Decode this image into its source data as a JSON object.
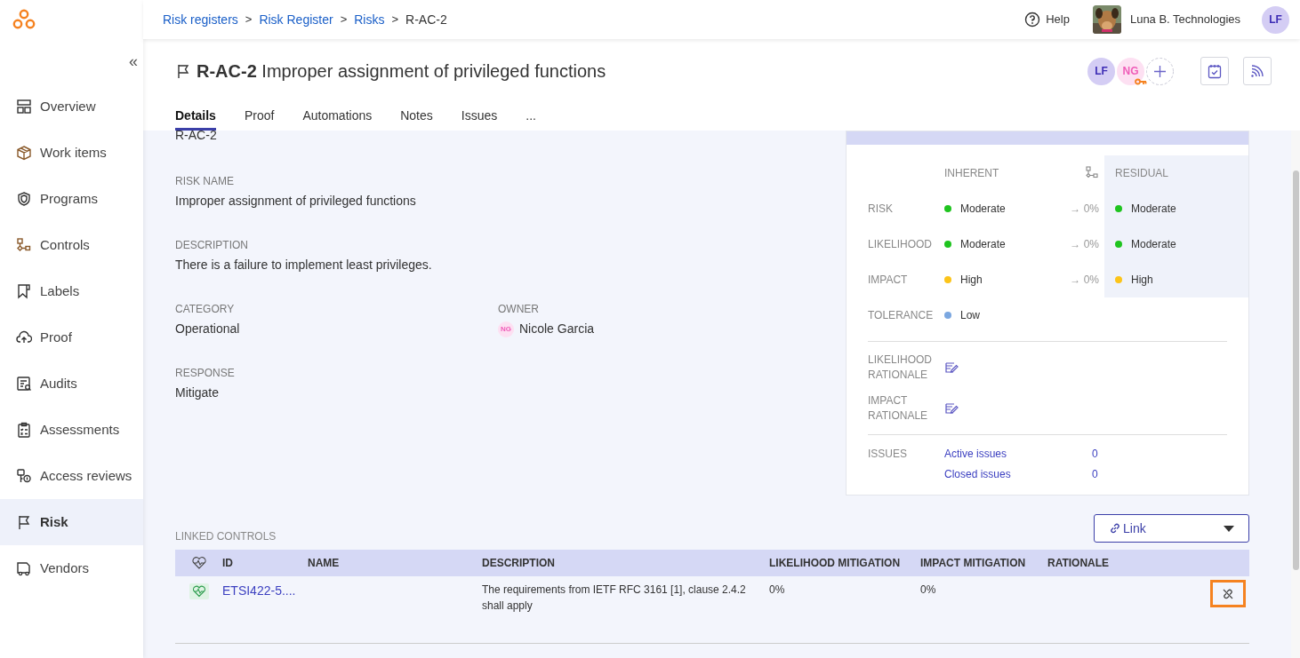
{
  "breadcrumbs": [
    {
      "label": "Risk registers",
      "kind": "link"
    },
    {
      "label": "Risk Register",
      "kind": "link"
    },
    {
      "label": "Risks",
      "kind": "link"
    },
    {
      "label": "R-AC-2",
      "kind": "current"
    }
  ],
  "separator": ">",
  "header": {
    "help": "Help",
    "organization": "Luna B. Technologies",
    "user_initials": "LF"
  },
  "sidebar": {
    "collapse": "«",
    "items": [
      {
        "label": "Overview",
        "selected": false
      },
      {
        "label": "Work items",
        "selected": false
      },
      {
        "label": "Programs",
        "selected": false
      },
      {
        "label": "Controls",
        "selected": false
      },
      {
        "label": "Labels",
        "selected": false
      },
      {
        "label": "Proof",
        "selected": false
      },
      {
        "label": "Audits",
        "selected": false
      },
      {
        "label": "Assessments",
        "selected": false
      },
      {
        "label": "Access reviews",
        "selected": false
      },
      {
        "label": "Risk",
        "selected": true
      },
      {
        "label": "Vendors",
        "selected": false
      }
    ]
  },
  "title": {
    "id": "R-AC-2",
    "name": "Improper assignment of privileged functions"
  },
  "assignees": [
    {
      "initials": "LF",
      "color": "#d4cdf4"
    },
    {
      "initials": "NG",
      "color": "#fde0f2"
    }
  ],
  "tabs": [
    {
      "label": "Details",
      "selected": true
    },
    {
      "label": "Proof",
      "selected": false
    },
    {
      "label": "Automations",
      "selected": false
    },
    {
      "label": "Notes",
      "selected": false
    },
    {
      "label": "Issues",
      "selected": false
    },
    {
      "label": "...",
      "selected": false
    }
  ],
  "details": {
    "id_value": "R-AC-2",
    "fields": [
      {
        "label": "RISK NAME",
        "value": "Improper assignment of privileged functions"
      },
      {
        "label": "DESCRIPTION",
        "value": "There is a failure to implement least privileges."
      },
      {
        "label": "CATEGORY",
        "value": "Operational"
      },
      {
        "label": "OWNER",
        "value": "Nicole Garcia",
        "owner_initials": "NG"
      },
      {
        "label": "RESPONSE",
        "value": "Mitigate"
      }
    ]
  },
  "assessment": {
    "inherent_heading": "INHERENT",
    "residual_heading": "RESIDUAL",
    "rows": [
      {
        "label": "RISK",
        "inherent": {
          "text": "Moderate",
          "color": "#1fc41f"
        },
        "change": "→ 0%",
        "residual": {
          "text": "Moderate",
          "color": "#1fc41f"
        }
      },
      {
        "label": "LIKELIHOOD",
        "inherent": {
          "text": "Moderate",
          "color": "#1fc41f"
        },
        "change": "→ 0%",
        "residual": {
          "text": "Moderate",
          "color": "#1fc41f"
        }
      },
      {
        "label": "IMPACT",
        "inherent": {
          "text": "High",
          "color": "#fcc419"
        },
        "change": "→ 0%",
        "residual": {
          "text": "High",
          "color": "#fcc419"
        }
      },
      {
        "label": "TOLERANCE",
        "inherent": {
          "text": "Low",
          "color": "#7ba7e0"
        }
      }
    ],
    "rationales": [
      "LIKELIHOOD RATIONALE",
      "IMPACT RATIONALE"
    ],
    "issues_label": "ISSUES",
    "issues": [
      {
        "label": "Active issues",
        "count": "0"
      },
      {
        "label": "Closed issues",
        "count": "0"
      }
    ]
  },
  "linked_controls": {
    "label": "LINKED CONTROLS",
    "link_button": "Link",
    "columns": [
      "ID",
      "NAME",
      "DESCRIPTION",
      "LIKELIHOOD MITIGATION",
      "IMPACT MITIGATION",
      "RATIONALE"
    ],
    "rows": [
      {
        "id": "ETSI422-5....",
        "description": "The requirements from IETF RFC 3161 [1], clause 2.4.2 shall apply",
        "likelihood_mitigation": "0%",
        "impact_mitigation": "0%",
        "unlink_focused": true
      }
    ]
  }
}
